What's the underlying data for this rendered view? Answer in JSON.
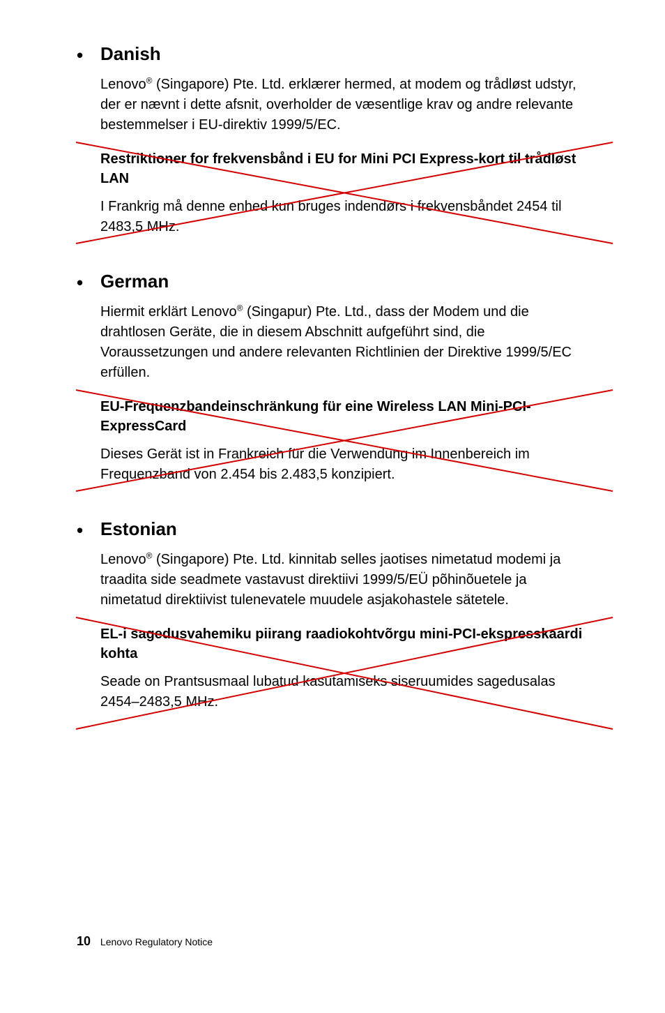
{
  "sections": [
    {
      "heading": "Danish",
      "intro": "Lenovo® (Singapore) Pte. Ltd. erklærer hermed, at modem og trådløst udstyr, der er nævnt i dette afsnit, overholder de væsentlige krav og andre relevante bestemmelser i EU-direktiv 1999/5/EC.",
      "subheading": "Restriktioner for frekvensbånd i EU for Mini PCI Express-kort til trådløst LAN",
      "subpara": "I Frankrig må denne enhed kun bruges indendørs i frekvensbåndet 2454 til 2483,5 MHz."
    },
    {
      "heading": "German",
      "intro": "Hiermit erklärt Lenovo® (Singapur) Pte. Ltd., dass der Modem und die drahtlosen Geräte, die in diesem Abschnitt aufgeführt sind, die Voraussetzungen und andere relevanten Richtlinien der Direktive 1999/5/EC erfüllen.",
      "subheading": "EU-Frequenzbandeinschränkung für eine Wireless LAN Mini-PCI-ExpressCard",
      "subpara": "Dieses Gerät ist in Frankreich für die Verwendung im Innenbereich im Frequenzband von 2.454 bis 2.483,5 konzipiert."
    },
    {
      "heading": "Estonian",
      "intro": "Lenovo® (Singapore) Pte. Ltd. kinnitab selles jaotises nimetatud modemi ja traadita side seadmete vastavust direktiivi 1999/5/EÜ põhinõuetele ja nimetatud direktiivist tulenevatele muudele asjakohastele sätetele.",
      "subheading": "EL-i sagedusvahemiku piirang raadiokohtvõrgu mini-PCI-ekspresskaardi kohta",
      "subpara": "Seade on Prantsusmaal lubatud kasutamiseks siseruumides sagedusalas 2454–2483,5 MHz."
    }
  ],
  "footer": {
    "page": "10",
    "title": "Lenovo Regulatory Notice"
  },
  "cross_color": "#d40000"
}
